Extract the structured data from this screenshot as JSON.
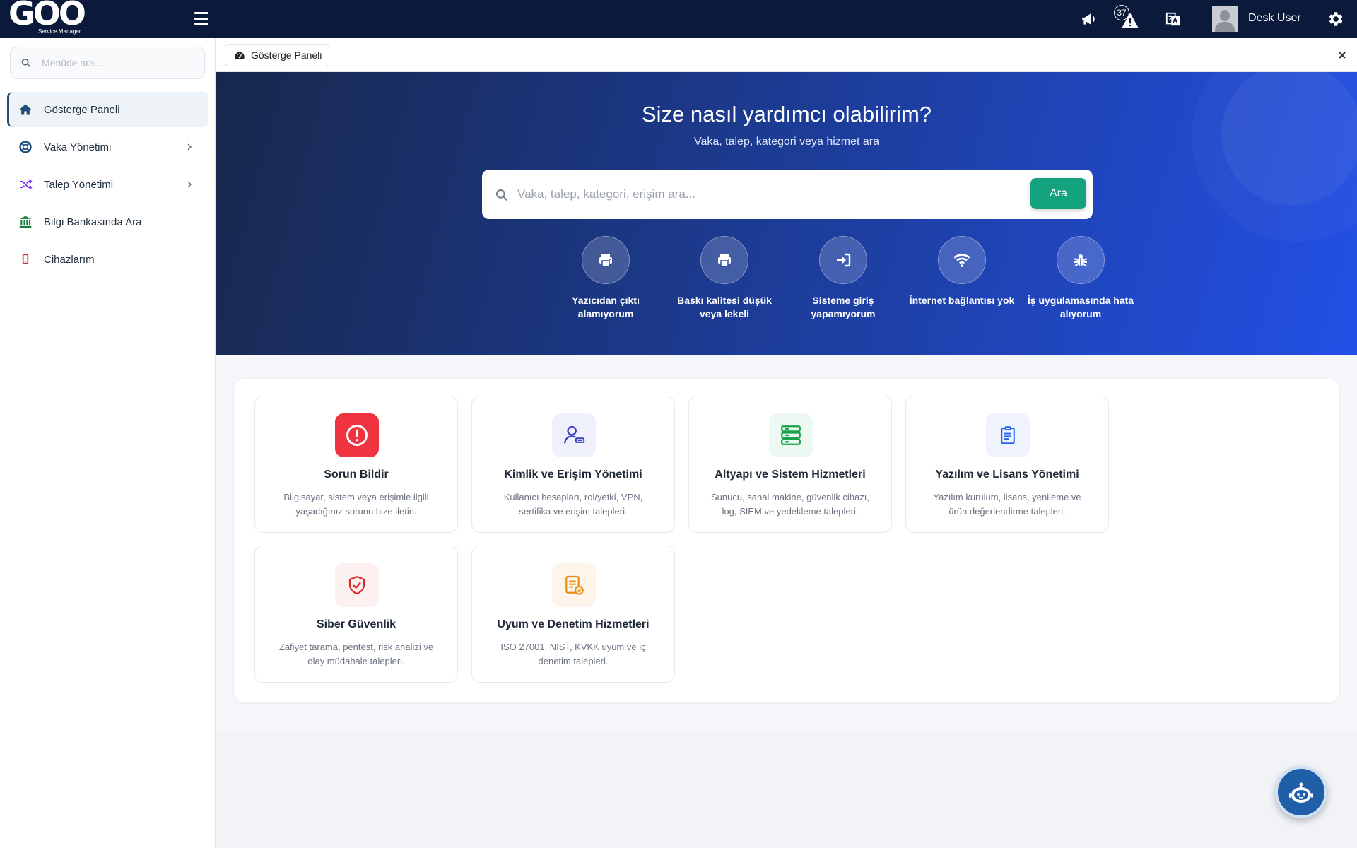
{
  "topbar": {
    "logo_text": "GOO",
    "logo_subtitle": "Service Manager",
    "notification_count": "37",
    "username": "Desk User"
  },
  "sidebar": {
    "search_placeholder": "Menüde ara...",
    "items": [
      {
        "label": "Gösterge Paneli",
        "icon": "home-icon",
        "color": "#1f4e79"
      },
      {
        "label": "Vaka Yönetimi",
        "icon": "lifebuoy-icon",
        "color": "#1f4e79"
      },
      {
        "label": "Talep Yönetimi",
        "icon": "shuffle-icon",
        "color": "#7c3aed"
      },
      {
        "label": "Bilgi Bankasında Ara",
        "icon": "bank-icon",
        "color": "#15803d"
      },
      {
        "label": "Cihazlarım",
        "icon": "mobile-icon",
        "color": "#dc2626"
      }
    ]
  },
  "tabbar": {
    "tab_label": "Gösterge Paneli"
  },
  "hero": {
    "title": "Size nasıl yardımcı olabilirim?",
    "subtitle": "Vaka, talep, kategori veya hizmet ara",
    "search_placeholder": "Vaka, talep, kategori, erişim ara...",
    "search_button": "Ara",
    "quick_actions": [
      {
        "line1": "Yazıcıdan çıktı",
        "line2": "alamıyorum",
        "icon": "printer-icon"
      },
      {
        "line1": "Baskı kalitesi düşük",
        "line2": "veya lekeli",
        "icon": "printer-icon"
      },
      {
        "line1": "Sisteme giriş",
        "line2": "yapamıyorum",
        "icon": "sign-in-icon"
      },
      {
        "line1": "İnternet bağlantısı yok",
        "line2": "",
        "icon": "wifi-icon"
      },
      {
        "line1": "İş uygulamasında hata",
        "line2": "alıyorum",
        "icon": "bug-icon"
      }
    ]
  },
  "cards": [
    {
      "title": "Sorun Bildir",
      "desc1": "Bilgisayar, sistem veya erişimle ilgili",
      "desc2": "yaşadığınız sorunu bize iletin.",
      "icon": "alert-circle-icon",
      "accent": "#ef3340"
    },
    {
      "title": "Kimlik ve Erişim Yönetimi",
      "desc1": "Kullanıcı hesapları, rol/yetki, VPN,",
      "desc2": "sertifika ve erişim talepleri.",
      "icon": "user-key-icon",
      "accent": "#3b3fc4"
    },
    {
      "title": "Altyapı ve Sistem Hizmetleri",
      "desc1": "Sunucu, sanal makine, güvenlik cihazı,",
      "desc2": "log, SIEM ve yedekleme talepleri.",
      "icon": "server-icon",
      "accent": "#16a34a"
    },
    {
      "title": "Yazılım ve Lisans Yönetimi",
      "desc1": "Yazılım kurulum, lisans, yenileme ve",
      "desc2": "ürün değerlendirme talepleri.",
      "icon": "document-icon",
      "accent": "#2563eb"
    },
    {
      "title": "Siber Güvenlik",
      "desc1": "Zafiyet tarama, pentest, risk analizi ve",
      "desc2": "olay müdahale talepleri.",
      "icon": "shield-check-icon",
      "accent": "#dc2626"
    },
    {
      "title": "Uyum ve Denetim Hizmetleri",
      "desc1": "ISO 27001, NIST, KVKK uyum ve iç",
      "desc2": "denetim talepleri.",
      "icon": "audit-icon",
      "accent": "#e88a0c"
    }
  ]
}
